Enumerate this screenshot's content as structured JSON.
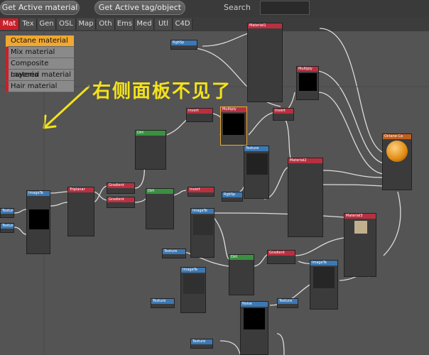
{
  "toolbar": {
    "get_active_material": "Get Active material",
    "get_active_tag": "Get Active tag/object",
    "search_label": "Search",
    "search_value": ""
  },
  "tabs": [
    "Mat",
    "Tex",
    "Gen",
    "OSL",
    "Map",
    "Oth",
    "Ems",
    "Med",
    "Utl",
    "C4D"
  ],
  "menu": [
    "Octane material",
    "Mix material",
    "Composite materia",
    "Layered material",
    "Hair material"
  ],
  "annotation": "右侧面板不见了",
  "colors": {
    "accent": "#c8202a",
    "selected": "#f0a830",
    "annotation": "#f4e21a"
  },
  "nodes": {
    "material1": "Material1",
    "multiply": "Multiply",
    "rgb": "RgbSp",
    "invert": "Invert",
    "dirt": "Dirt",
    "gradient": "Gradient",
    "texture": "Texture",
    "imagetex": "ImageTe",
    "triplanar": "Triplanar",
    "material2": "Material2",
    "octane_mat": "Octane Ca",
    "material3": "Material3",
    "noise": "Noise"
  }
}
